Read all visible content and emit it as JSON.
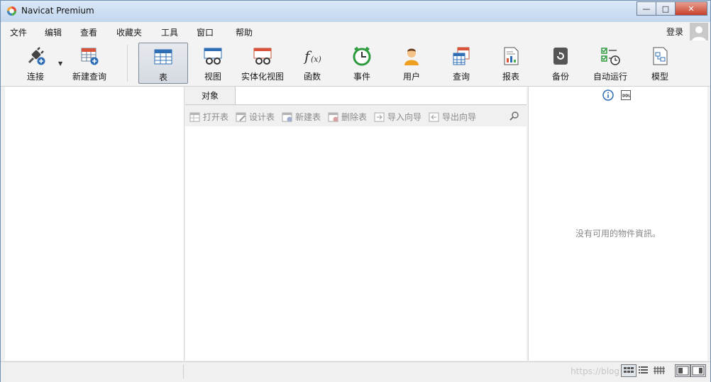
{
  "window": {
    "title": "Navicat Premium"
  },
  "menu": {
    "items": [
      "文件",
      "编辑",
      "查看",
      "收藏夹",
      "工具",
      "窗口",
      "帮助"
    ],
    "login": "登录"
  },
  "toolbar": {
    "connect": "连接",
    "new_query": "新建查询",
    "buttons": [
      "表",
      "视图",
      "实体化视图",
      "函数",
      "事件",
      "用户",
      "查询",
      "报表",
      "备份",
      "自动运行",
      "模型"
    ],
    "active": "表"
  },
  "center": {
    "tab": "对象",
    "actions": [
      "打开表",
      "设计表",
      "新建表",
      "删除表",
      "导入向导",
      "导出向导"
    ]
  },
  "right": {
    "no_info": "没有可用的物件資訊。"
  },
  "status": {
    "watermark": "https://blog"
  },
  "colors": {
    "title_bar": "#c2d6ee",
    "accent_blue": "#2f6db5",
    "close_red": "#c7402a"
  }
}
